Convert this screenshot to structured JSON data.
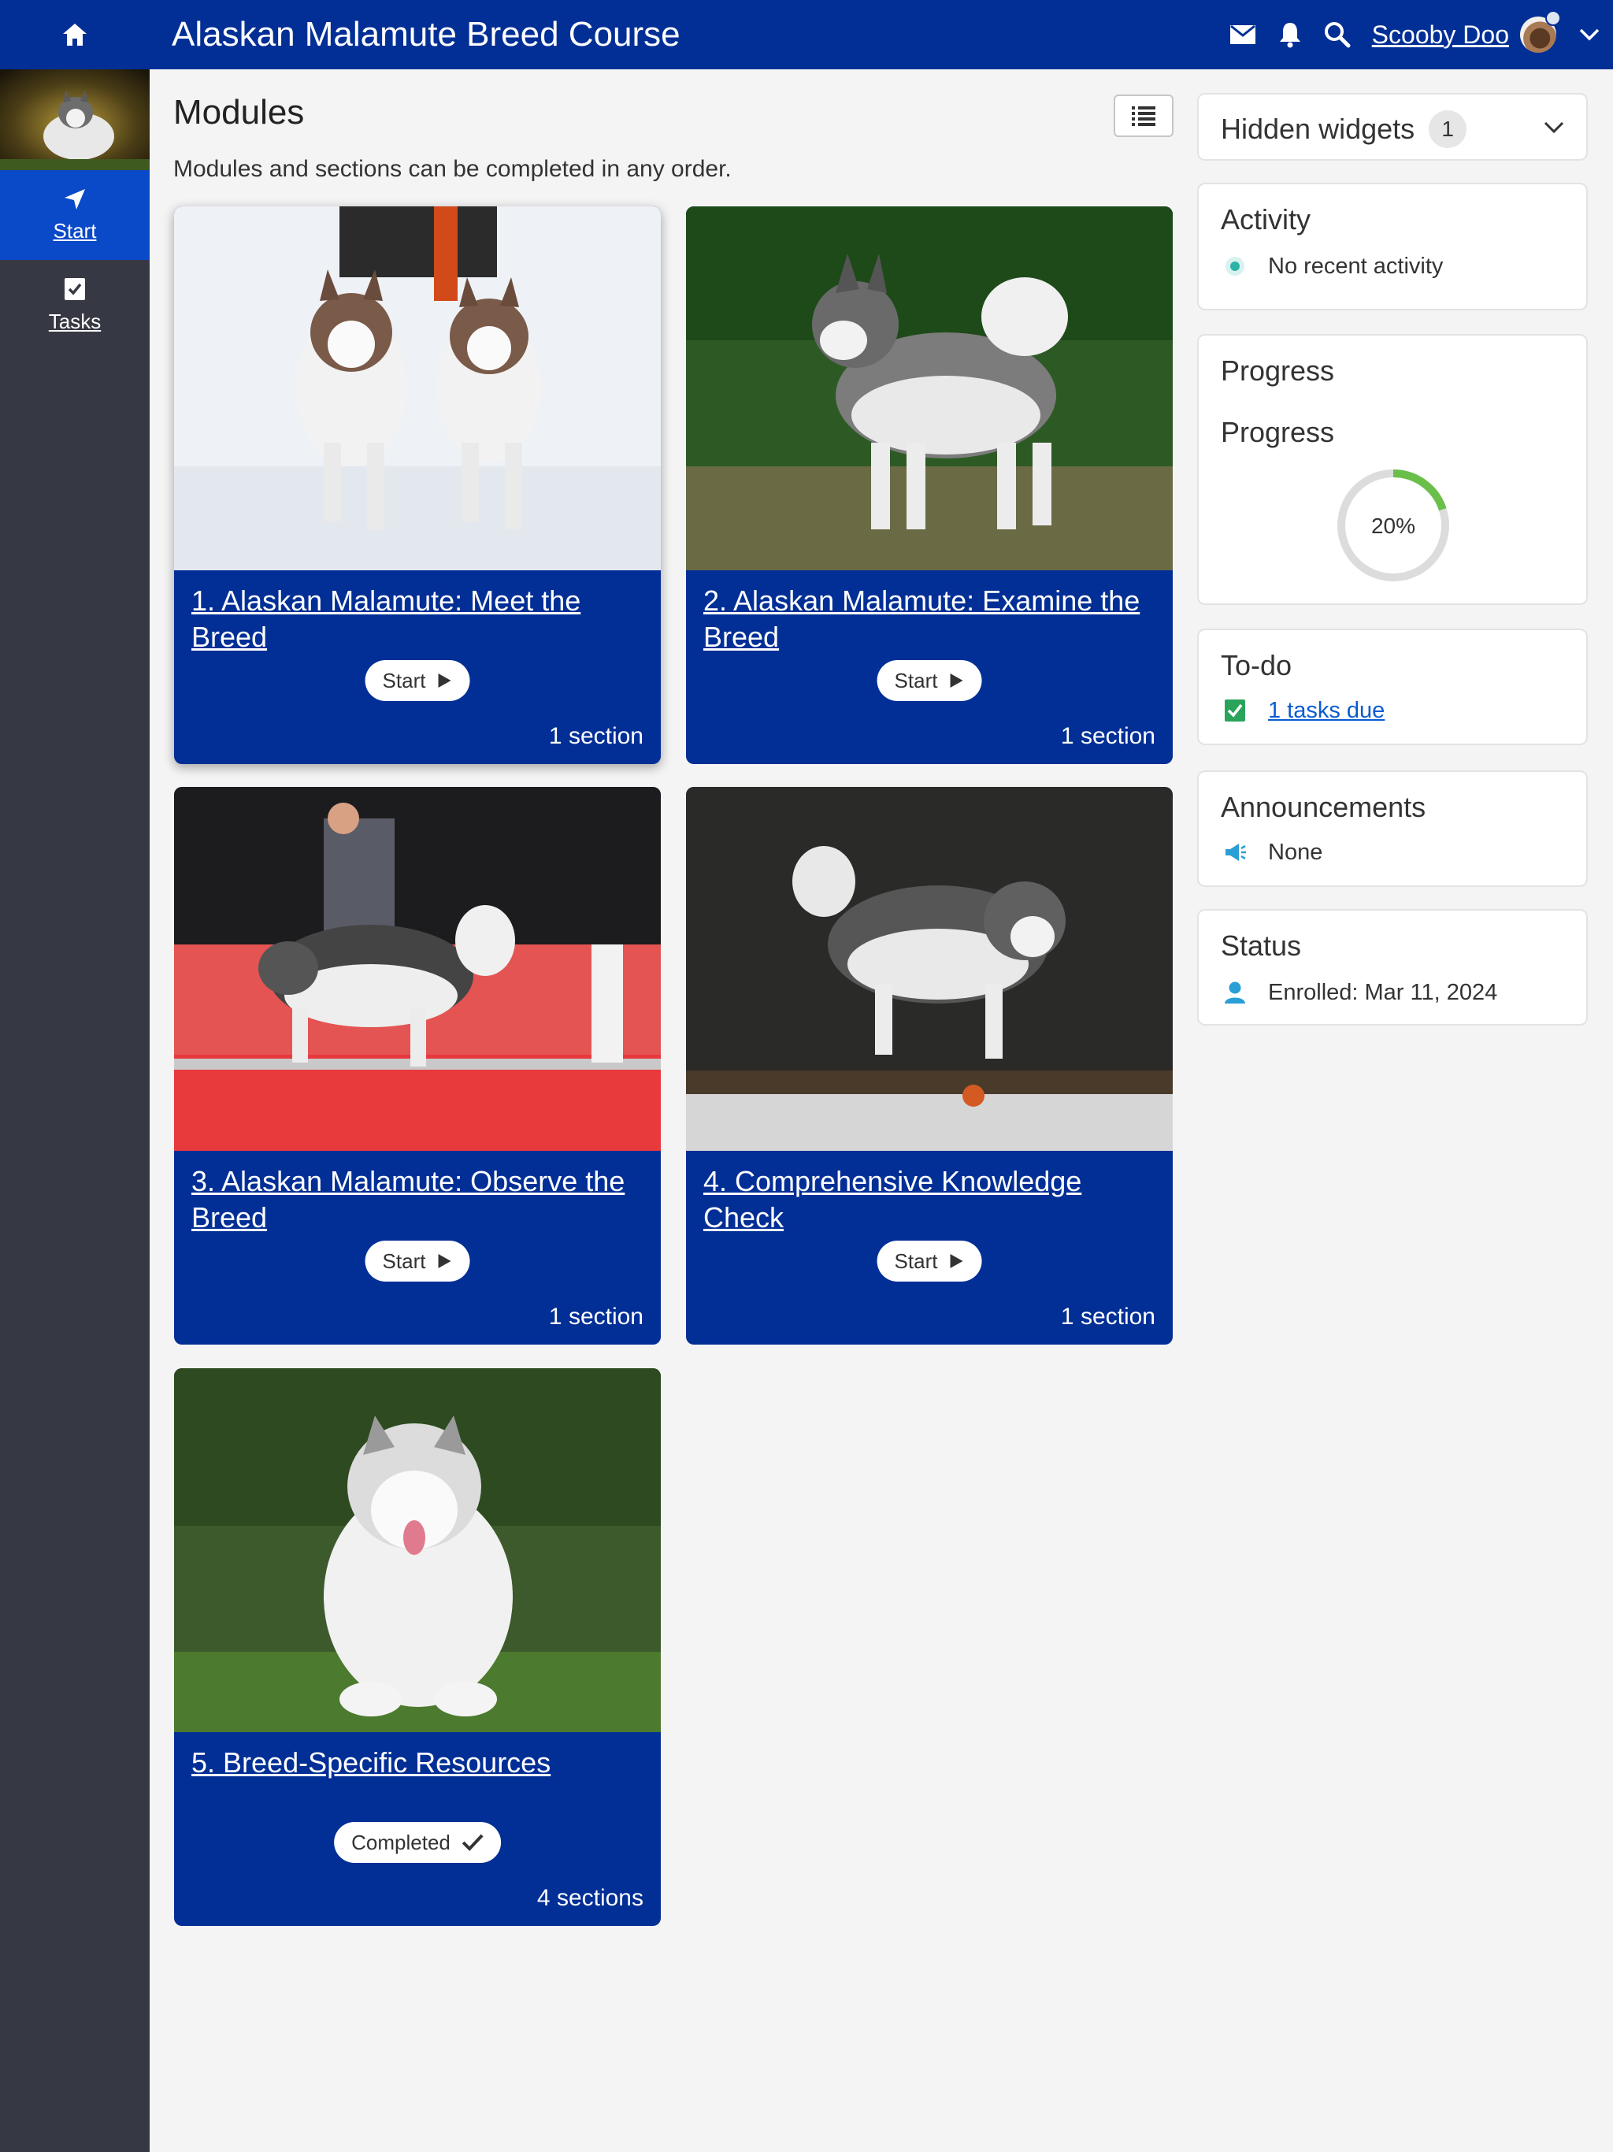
{
  "header": {
    "title": "Alaskan Malamute Breed Course",
    "user_name": "Scooby Doo",
    "icons": [
      "home-icon",
      "envelope-icon",
      "bell-icon",
      "search-icon",
      "chevron-down-icon"
    ]
  },
  "sidebar": {
    "items": [
      {
        "label": "Start",
        "icon": "navigation-arrow-icon",
        "active": true
      },
      {
        "label": "Tasks",
        "icon": "checkbox-icon",
        "active": false
      }
    ]
  },
  "main": {
    "title": "Modules",
    "subtitle": "Modules and sections can be completed in any order.",
    "modules": [
      {
        "title": "1. Alaskan Malamute: Meet the Breed",
        "action": "Start",
        "sections": "1 section"
      },
      {
        "title": "2. Alaskan Malamute: Examine the Breed",
        "action": "Start",
        "sections": "1 section"
      },
      {
        "title": "3. Alaskan Malamute: Observe the Breed",
        "action": "Start",
        "sections": "1 section"
      },
      {
        "title": "4. Comprehensive Knowledge Check",
        "action": "Start",
        "sections": "1 section"
      },
      {
        "title": "5. Breed-Specific Resources",
        "action": "Completed",
        "sections": "4 sections"
      }
    ]
  },
  "widgets": {
    "hidden": {
      "label": "Hidden widgets",
      "count": "1"
    },
    "activity": {
      "title": "Activity",
      "text": "No recent activity"
    },
    "progress": {
      "title": "Progress",
      "subtitle": "Progress",
      "value_label": "20%",
      "value": 0.2,
      "color": "#6abf4b"
    },
    "todo": {
      "title": "To-do",
      "link": "1 tasks due"
    },
    "announcements": {
      "title": "Announcements",
      "text": "None"
    },
    "status": {
      "title": "Status",
      "text": "Enrolled: Mar 11, 2024"
    }
  },
  "colors": {
    "brand": "#022f96",
    "sidebar": "#363844",
    "active": "#0a49c7",
    "accent": "#2a9fd6"
  }
}
